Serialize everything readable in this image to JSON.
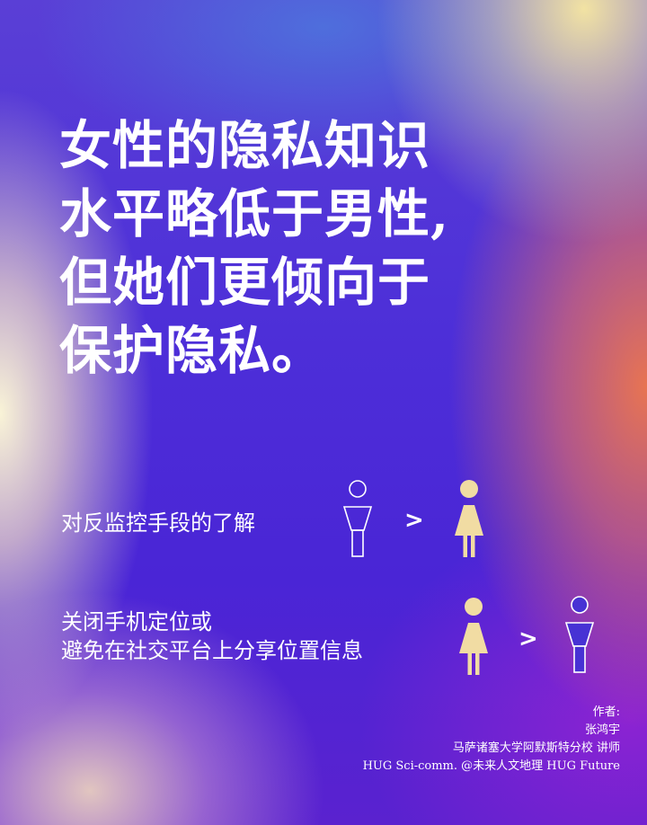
{
  "headline": {
    "lines": [
      "女性的隐私知识",
      "水平略低于男性,",
      "但她们更倾向于",
      "保护隐私。"
    ]
  },
  "comparisons": [
    {
      "label_lines": [
        "对反监控手段的了解"
      ],
      "symbol": ">",
      "left_icon": "male-outline-icon",
      "right_icon": "female-filled-icon"
    },
    {
      "label_lines": [
        "关闭手机定位或",
        "避免在社交平台上分享位置信息"
      ],
      "symbol": ">",
      "left_icon": "female-filled-icon",
      "right_icon": "male-filled-icon"
    }
  ],
  "credit": {
    "label": "作者:",
    "name": "张鸿宇",
    "affiliation": "马萨诸塞大学阿默斯特分校 讲师",
    "source": "HUG Sci-comm.  @未来人文地理 HUG Future"
  },
  "colors": {
    "female_fill": "#f1dca3",
    "male_fill": "#4732d4",
    "outline": "#ffffff"
  }
}
